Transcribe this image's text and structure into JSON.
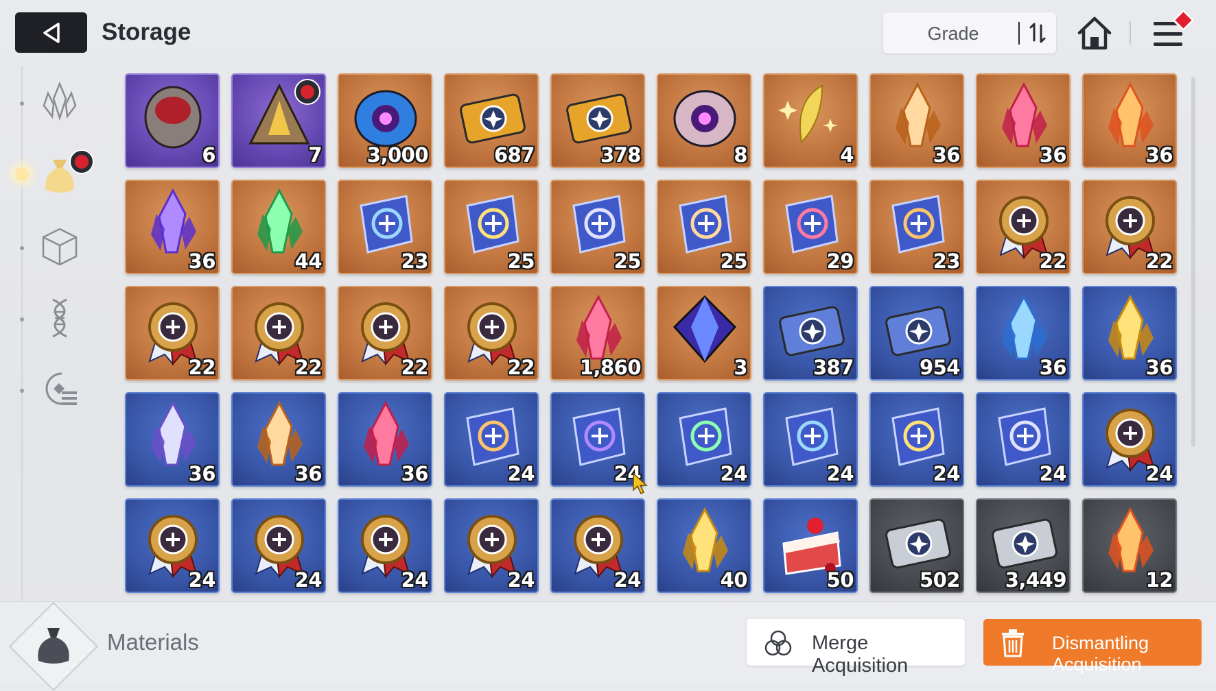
{
  "header": {
    "title": "Storage",
    "sort_label": "Grade"
  },
  "sidebar": {
    "items": [
      {
        "icon": "crystal-icon",
        "active": false
      },
      {
        "icon": "materials-bag-icon",
        "active": true,
        "badge": true
      },
      {
        "icon": "cube-icon",
        "active": false
      },
      {
        "icon": "dna-icon",
        "active": false
      },
      {
        "icon": "chip-list-icon",
        "active": false
      }
    ]
  },
  "items": [
    {
      "name": "dark-skull-stone",
      "grade": "purple",
      "count": "6"
    },
    {
      "name": "pyramid-artifact",
      "grade": "purple",
      "count": "7",
      "badge": true
    },
    {
      "name": "blue-eye-spirit",
      "grade": "orange",
      "count": "3,000"
    },
    {
      "name": "gold-character-ticket",
      "grade": "orange",
      "count": "687"
    },
    {
      "name": "gold-star-ticket",
      "grade": "orange",
      "count": "378"
    },
    {
      "name": "purple-eye-core",
      "grade": "orange",
      "count": "8"
    },
    {
      "name": "gold-moon-feather",
      "grade": "orange",
      "count": "4"
    },
    {
      "name": "red-crystal",
      "grade": "orange",
      "count": "36"
    },
    {
      "name": "orange-crystal",
      "grade": "orange",
      "count": "36"
    },
    {
      "name": "purple-crystal",
      "grade": "orange",
      "count": "36"
    },
    {
      "name": "green-crystal",
      "grade": "orange",
      "count": "36"
    },
    {
      "name": "blue-crystal",
      "grade": "orange",
      "count": "44"
    },
    {
      "name": "sword-skill-book",
      "grade": "orange",
      "count": "23"
    },
    {
      "name": "shield-skill-book",
      "grade": "orange",
      "count": "25"
    },
    {
      "name": "target-skill-book",
      "grade": "orange",
      "count": "25"
    },
    {
      "name": "wings-skill-book",
      "grade": "orange",
      "count": "25"
    },
    {
      "name": "bolt-skill-book",
      "grade": "orange",
      "count": "29"
    },
    {
      "name": "orb-skill-book",
      "grade": "orange",
      "count": "23"
    },
    {
      "name": "sword-medal",
      "grade": "orange",
      "count": "22"
    },
    {
      "name": "shield-medal",
      "grade": "orange",
      "count": "22"
    },
    {
      "name": "target-medal",
      "grade": "orange",
      "count": "22"
    },
    {
      "name": "wings-medal",
      "grade": "orange",
      "count": "22"
    },
    {
      "name": "bolt-medal",
      "grade": "orange",
      "count": "22"
    },
    {
      "name": "orb-medal",
      "grade": "orange",
      "count": "22"
    },
    {
      "name": "gold-shard-cluster",
      "grade": "orange",
      "count": "1,860"
    },
    {
      "name": "dark-prism-gem",
      "grade": "orange",
      "count": "3"
    },
    {
      "name": "blue-character-ticket",
      "grade": "blue",
      "count": "387"
    },
    {
      "name": "blue-star-ticket",
      "grade": "blue",
      "count": "954"
    },
    {
      "name": "red-crystal-shard",
      "grade": "blue",
      "count": "36"
    },
    {
      "name": "orange-crystal-shard",
      "grade": "blue",
      "count": "36"
    },
    {
      "name": "purple-crystal-shard",
      "grade": "blue",
      "count": "36"
    },
    {
      "name": "green-crystal-shard",
      "grade": "blue",
      "count": "36"
    },
    {
      "name": "blue-crystal-shard",
      "grade": "blue",
      "count": "36"
    },
    {
      "name": "sword-tome",
      "grade": "blue",
      "count": "24"
    },
    {
      "name": "shield-tome",
      "grade": "blue",
      "count": "24"
    },
    {
      "name": "target-tome",
      "grade": "blue",
      "count": "24"
    },
    {
      "name": "wings-tome",
      "grade": "blue",
      "count": "24"
    },
    {
      "name": "bolt-tome",
      "grade": "blue",
      "count": "24"
    },
    {
      "name": "orb-tome",
      "grade": "blue",
      "count": "24"
    },
    {
      "name": "sword-badge",
      "grade": "blue",
      "count": "24"
    },
    {
      "name": "shield-badge",
      "grade": "blue",
      "count": "24"
    },
    {
      "name": "target-badge",
      "grade": "blue",
      "count": "24"
    },
    {
      "name": "wings-badge",
      "grade": "blue",
      "count": "24"
    },
    {
      "name": "bolt-badge",
      "grade": "blue",
      "count": "24"
    },
    {
      "name": "orb-badge",
      "grade": "blue",
      "count": "24"
    },
    {
      "name": "blue-flame-crystal",
      "grade": "blue",
      "count": "40"
    },
    {
      "name": "strawberry-cake",
      "grade": "blue",
      "count": "50"
    },
    {
      "name": "silver-character-ticket",
      "grade": "gray",
      "count": "502"
    },
    {
      "name": "silver-star-ticket",
      "grade": "gray",
      "count": "3,449"
    },
    {
      "name": "red-gem-fragment",
      "grade": "gray",
      "count": "12"
    }
  ],
  "footer": {
    "category_label": "Materials",
    "merge_label": "Merge Acquisition",
    "dismantle_label": "Dismantling Acquisition"
  },
  "colors": {
    "dismantle_accent": "#ee7a2a",
    "orange_grade": "#c37741",
    "purple_grade": "#6548b2",
    "blue_grade": "#3956a8",
    "gray_grade": "#484a51"
  }
}
